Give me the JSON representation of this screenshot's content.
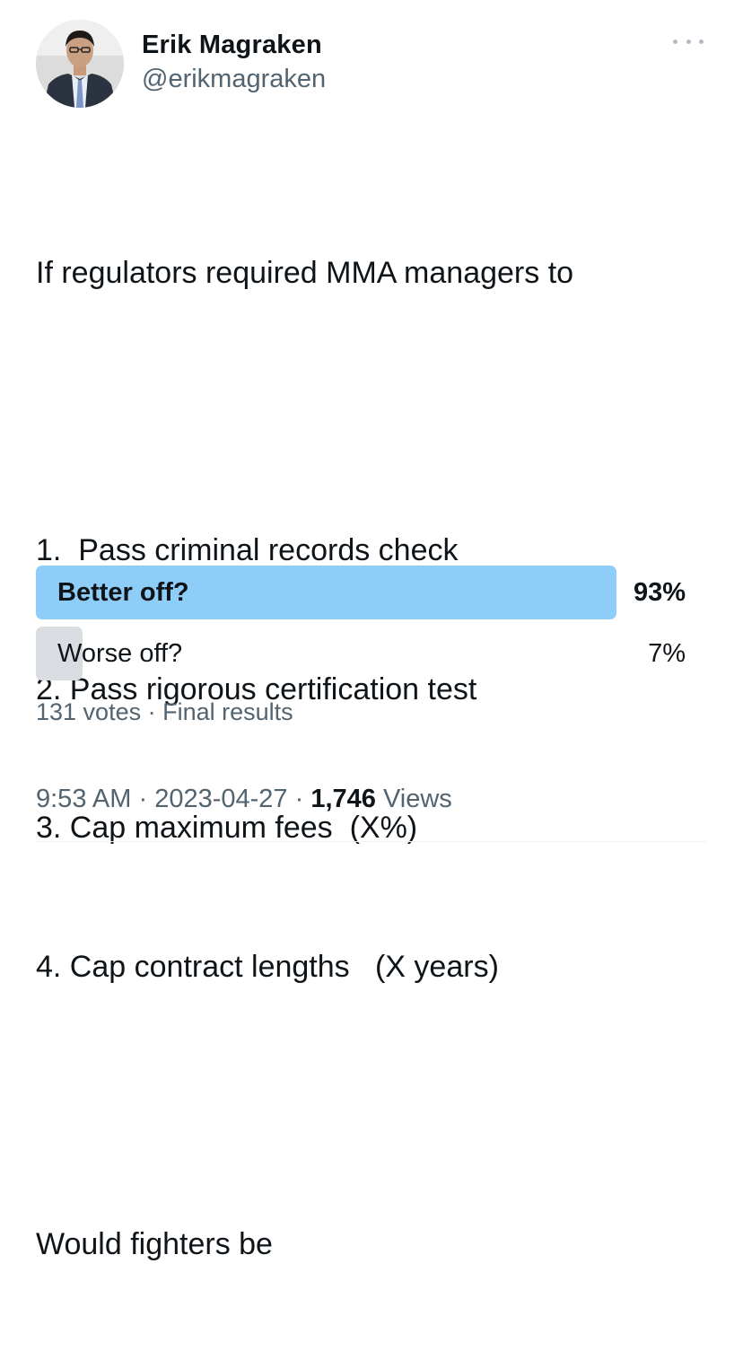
{
  "author": {
    "display_name": "Erik Magraken",
    "handle": "@erikmagraken"
  },
  "tweet": {
    "lines": [
      "If regulators required MMA managers to",
      "",
      "1.  Pass criminal records check",
      "2. Pass rigorous certification test",
      "3. Cap maximum fees  (X%)",
      "4. Cap contract lengths   (X years)",
      "",
      "Would fighters be"
    ]
  },
  "poll": {
    "options": [
      {
        "label": "Better off?",
        "percent_text": "93%",
        "percent": 93,
        "winner": true
      },
      {
        "label": "Worse off?",
        "percent_text": "7%",
        "percent": 7,
        "winner": false
      }
    ],
    "votes": "131 votes",
    "separator": " · ",
    "status": "Final results"
  },
  "footer": {
    "time": "9:53 AM",
    "date": "2023-04-27",
    "views_count": "1,746",
    "views_label": "Views",
    "separator": " · "
  },
  "colors": {
    "winner_bar": "#8ecdf8",
    "loser_bar": "#d9dde1",
    "secondary_text": "#536471",
    "primary_text": "#0f1419"
  },
  "icons": {
    "more": "more-horizontal-icon",
    "avatar": "profile-photo"
  }
}
